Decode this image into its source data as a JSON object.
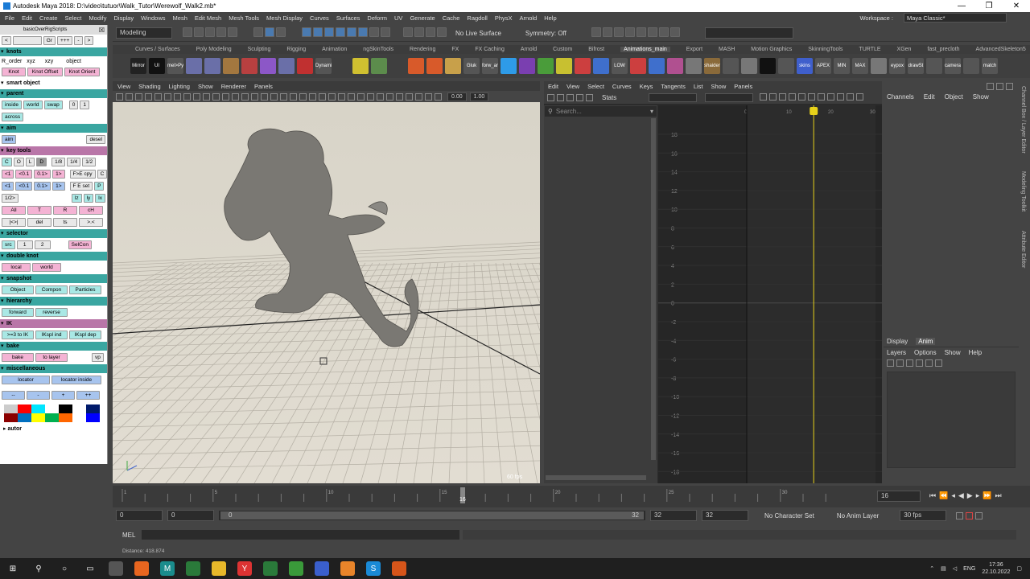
{
  "window": {
    "title": "Autodesk Maya 2018: D:\\video\\tutuor\\Walk_Tutor\\Werewolf_Walk2.mb*",
    "controls": [
      "—",
      "❐",
      "✕"
    ]
  },
  "menubar": {
    "items": [
      "File",
      "Edit",
      "Create",
      "Select",
      "Modify",
      "Display",
      "Windows",
      "Mesh",
      "Edit Mesh",
      "Mesh Tools",
      "Mesh Display",
      "Curves",
      "Surfaces",
      "Deform",
      "UV",
      "Generate",
      "Cache",
      "Ragdoll",
      "PhysX",
      "Arnold",
      "Help"
    ],
    "workspace_label": "Workspace :",
    "workspace_value": "Maya Classic*"
  },
  "statusline": {
    "mode": "Modeling",
    "live_surface": "No Live Surface",
    "symmetry": "Symmetry: Off"
  },
  "shelf": {
    "tabs": [
      "Curves / Surfaces",
      "Poly Modeling",
      "Sculpting",
      "Rigging",
      "Animation",
      "ngSkinTools",
      "Rendering",
      "FX",
      "FX Caching",
      "Arnold",
      "Custom",
      "Bifrost",
      "Animations_main",
      "Export",
      "MASH",
      "Motion Graphics",
      "SkinningTools",
      "TURTLE",
      "XGen",
      "fast_precloth",
      "AdvancedSkeleton5"
    ],
    "active_tab": "Animations_main",
    "icons": [
      {
        "label": "Mirror TOOL",
        "color": "#222"
      },
      {
        "label": "UI",
        "color": "#111"
      },
      {
        "label": "mel>Py",
        "color": "#555"
      },
      {
        "label": "",
        "color": "#6a6fa8"
      },
      {
        "label": "",
        "color": "#6a6fa8"
      },
      {
        "label": "",
        "color": "#a3773f"
      },
      {
        "label": "",
        "color": "#b84040"
      },
      {
        "label": "",
        "color": "#8c57c7"
      },
      {
        "label": "",
        "color": "#6a6fa8"
      },
      {
        "label": "",
        "color": "#c03030"
      },
      {
        "label": "Dynami",
        "color": "#555"
      },
      {
        "label": "",
        "color": "#3f3f3f"
      },
      {
        "label": "",
        "color": "#d0c030"
      },
      {
        "label": "",
        "color": "#5c8c4c"
      },
      {
        "label": "",
        "color": "#3f3f3f"
      },
      {
        "label": "",
        "color": "#d85a2a"
      },
      {
        "label": "",
        "color": "#d85a2a"
      },
      {
        "label": "",
        "color": "#c8a04a"
      },
      {
        "label": "Gluk",
        "color": "#555"
      },
      {
        "label": "forw_ar",
        "color": "#555"
      },
      {
        "label": "",
        "color": "#2e9be8"
      },
      {
        "label": "",
        "color": "#7a3fb0"
      },
      {
        "label": "",
        "color": "#4a9c3a"
      },
      {
        "label": "",
        "color": "#c8c030"
      },
      {
        "label": "",
        "color": "#cc3f3f"
      },
      {
        "label": "",
        "color": "#3f6fcc"
      },
      {
        "label": "LOW",
        "color": "#555"
      },
      {
        "label": "",
        "color": "#cc3f3f"
      },
      {
        "label": "",
        "color": "#3f6fcc"
      },
      {
        "label": "",
        "color": "#b05090"
      },
      {
        "label": "",
        "color": "#777"
      },
      {
        "label": "shaider",
        "color": "#8a6a3a"
      },
      {
        "label": "",
        "color": "#555"
      },
      {
        "label": "",
        "color": "#777"
      },
      {
        "label": "",
        "color": "#111"
      },
      {
        "label": "",
        "color": "#555"
      },
      {
        "label": "skins",
        "color": "#3f5fcc"
      },
      {
        "label": "APEX",
        "color": "#555"
      },
      {
        "label": "MIN",
        "color": "#555"
      },
      {
        "label": "MAX",
        "color": "#555"
      },
      {
        "label": "",
        "color": "#777"
      },
      {
        "label": "eypox",
        "color": "#555"
      },
      {
        "label": "drawSt",
        "color": "#555"
      },
      {
        "label": "",
        "color": "#555"
      },
      {
        "label": "camera",
        "color": "#555"
      },
      {
        "label": "",
        "color": "#555"
      },
      {
        "label": "match",
        "color": "#555"
      }
    ]
  },
  "leftpanel": {
    "script_title": "basicOverRigScripts",
    "rorder": {
      "label": "R_order",
      "options": [
        "xyz",
        "xzy",
        "object"
      ]
    },
    "sections": {
      "knots": {
        "title": "knots",
        "buttons": [
          "Knot",
          "Knot Offset",
          "Knot Orient"
        ]
      },
      "smart_object": {
        "title": "smart object"
      },
      "parent": {
        "title": "parent",
        "buttons": [
          "inside",
          "world",
          "swap"
        ],
        "nums": [
          "0",
          "1"
        ],
        "across": "across"
      },
      "aim": {
        "title": "aim",
        "buttons": [
          "aim",
          "desel"
        ]
      },
      "key_tools": {
        "title": "key tools",
        "row1": [
          "C",
          "O",
          "L",
          "D"
        ],
        "row1b": [
          "1/8",
          "1/4",
          "1/2"
        ],
        "row2": [
          "<1",
          "<0.1",
          "0.1>",
          "1>"
        ],
        "row2b": [
          "F>E cpy",
          "C"
        ],
        "row3": [
          "<1",
          "<0.1",
          "0.1>",
          "1>"
        ],
        "row3b": [
          "F E set",
          "P"
        ],
        "row4a": "1/2>",
        "row4b": [
          "lz",
          "ly",
          "lx"
        ],
        "row5": [
          "All",
          "T",
          "R",
          "cH"
        ],
        "row6": [
          "|<>|",
          "del",
          "ts",
          ">.<"
        ]
      },
      "selector": {
        "title": "selector",
        "buttons": [
          "src",
          "1",
          "2",
          "SelCon"
        ]
      },
      "double_knot": {
        "title": "double knot",
        "buttons": [
          "local",
          "world"
        ]
      },
      "snapshot": {
        "title": "snapshot",
        "buttons": [
          "Object",
          "Compon",
          "Particles"
        ]
      },
      "hierarchy": {
        "title": "hierarchy",
        "buttons": [
          "forward",
          "reverse"
        ]
      },
      "ik": {
        "title": "IK",
        "buttons": [
          ">=3 to IK",
          "IKspl ind",
          "IKspl dep"
        ]
      },
      "bake": {
        "title": "bake",
        "buttons": [
          "bake",
          "to layer",
          "vp"
        ]
      },
      "misc": {
        "title": "miscellaneous",
        "buttons": [
          "locator",
          "locator inside"
        ]
      },
      "adjust": [
        "--",
        "-",
        "+",
        "++"
      ],
      "autor": "autor"
    },
    "swatches": [
      "#cccccc",
      "#ff0000",
      "#00e5ff",
      "#ffffff",
      "#000000",
      "#ffffff",
      "#001a6b",
      "#8b0000",
      "#0070c0",
      "#ffff00",
      "#00b050",
      "#ff6600",
      "#ffffff",
      "#0000ff"
    ]
  },
  "viewport": {
    "menu": [
      "View",
      "Shading",
      "Lighting",
      "Show",
      "Renderer",
      "Panels"
    ],
    "field1": "0.00",
    "field2": "1.00",
    "hud_fps": "60 fps"
  },
  "graph_editor": {
    "menu": [
      "Edit",
      "View",
      "Select",
      "Curves",
      "Keys",
      "Tangents",
      "List",
      "Show",
      "Panels"
    ],
    "stats": "Stats",
    "search_placeholder": "Search...",
    "y_labels": [
      "18",
      "16",
      "14",
      "12",
      "10",
      "8",
      "6",
      "4",
      "2",
      "0",
      "-2",
      "-4",
      "-6",
      "-8",
      "-10",
      "-12",
      "-14",
      "-16",
      "-18"
    ],
    "x_labels": [
      "0",
      "10",
      "16",
      "20",
      "30"
    ],
    "current_frame": "16"
  },
  "channel_box": {
    "menu": [
      "Channels",
      "Edit",
      "Object",
      "Show"
    ]
  },
  "layer_editor": {
    "tabs": [
      "Display",
      "Anim"
    ],
    "active": "Anim",
    "menu": [
      "Layers",
      "Options",
      "Show",
      "Help"
    ]
  },
  "right_strip": {
    "labels": [
      "Channel Box / Layer Editor",
      "Modeling Toolkit",
      "Attribute Editor"
    ]
  },
  "timeline": {
    "ticks": [
      "1",
      "5",
      "10",
      "15",
      "20",
      "25",
      "30"
    ],
    "current": "16",
    "current_field": "16"
  },
  "range": {
    "start": "0",
    "anim_start": "0",
    "slider_start": "0",
    "slider_end": "32",
    "end": "32",
    "anim_end": "32",
    "char_set": "No Character Set",
    "anim_layer": "No Anim Layer",
    "fps": "30 fps"
  },
  "command": {
    "label": "MEL"
  },
  "helpline": {
    "text": "Distance: 418.874"
  },
  "taskbar": {
    "time": "17:36",
    "date": "22.10.2022",
    "lang": "ENG"
  }
}
